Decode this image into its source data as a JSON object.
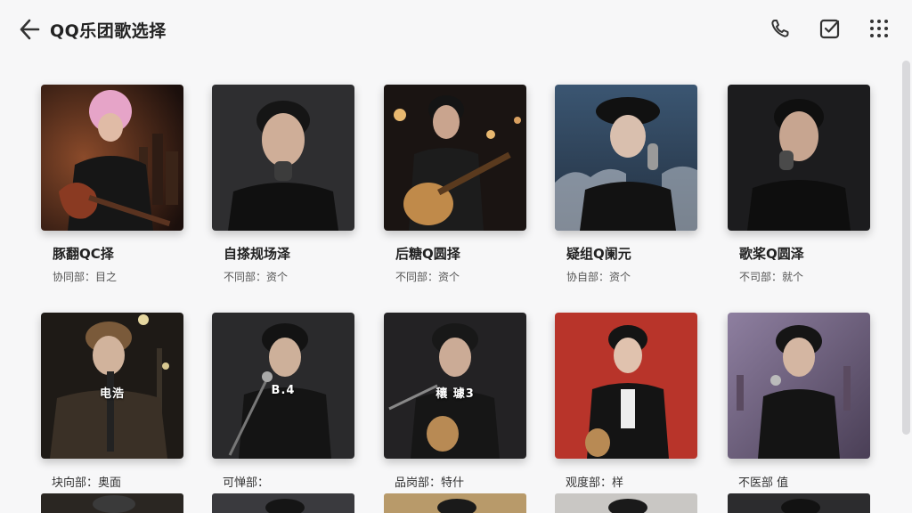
{
  "header": {
    "title": "QQ乐团歌选择",
    "icons": {
      "back": "back-icon",
      "phone": "phone-icon",
      "checklist": "checklist-icon",
      "more": "grid-dots-icon"
    }
  },
  "cards_row1": [
    {
      "title": "豚翻QC择",
      "subtitle": "协同部：目之"
    },
    {
      "title": "自搽规场泽",
      "subtitle": "不同部：资个"
    },
    {
      "title": "后糖Q圆择",
      "subtitle": "不同部：资个"
    },
    {
      "title": "疑组Q阑元",
      "subtitle": "协自部：资个"
    },
    {
      "title": "歌桨Q圆泽",
      "subtitle": "不司部：就个"
    }
  ],
  "cards_row2": [
    {
      "overlay": "电浩",
      "subtitle": "块向部：奥面"
    },
    {
      "overlay": "B.4",
      "subtitle": "可惮部："
    },
    {
      "overlay": "穰 璩3",
      "subtitle": "品岗部：特什"
    },
    {
      "overlay": "",
      "subtitle": "观度部：样"
    },
    {
      "overlay": "",
      "subtitle": "不医部 值"
    }
  ],
  "colors": {
    "background": "#f7f7f8",
    "text_primary": "#222222",
    "text_secondary": "#555555"
  }
}
